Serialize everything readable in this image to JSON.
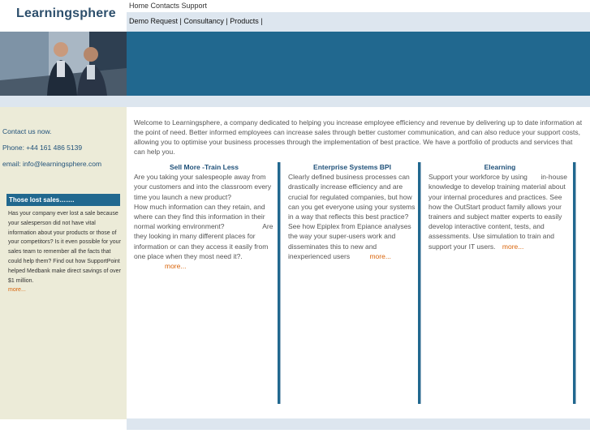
{
  "logo": "Learningsphere",
  "topnav": "Home Contacts Support",
  "subnav": "Demo Request | Consultancy | Products |",
  "sidebar": {
    "contact": "Contact us now.",
    "phone": "Phone: +44 161 486 5139",
    "email": "email: info@learningsphere.com",
    "box_title": "Those lost sales…….",
    "box_text": "Has your company ever lost a sale because your salesperson did not have vital information about your products or those of your competitors? Is it even possible for your sales team to remember all the facts that could help them? Find out how SupportPoint helped Medbank make direct savings of over  $1 million.",
    "box_more": "more..."
  },
  "welcome": "Welcome to Learningsphere, a company dedicated to helping you increase employee efficiency and revenue by delivering up to date information at the point of need. Better informed employees can increase sales through better customer communication, and can also reduce your support costs, allowing you to optimise your business processes through the implementation of best practice. We have a portfolio of products and services that can help you.",
  "columns": [
    {
      "title": "Sell More -Train Less",
      "text": "Are you taking your salespeople away from your customers and into the classroom every time you launch a new product?                       How much information can they retain, and where can they find this information in their normal working environment?                    Are they looking in many different places for information or can they access it easily from one place when they most need it?.",
      "more": "more..."
    },
    {
      "title": "Enterprise Systems BPI",
      "text": "Clearly defined business processes can drastically increase efficiency and are crucial for regulated companies, but how can you get everyone using your systems in a way that reflects this best practice? See how Epiplex from Epiance analyses the way your super-users work and disseminates this to new and inexperienced users",
      "more": "more..."
    },
    {
      "title": "Elearning",
      "text": "Support your workforce by using       in-house knowledge to develop training material about your internal procedures and practices. See how the OutStart product family allows your trainers and subject matter experts to easily develop interactive content, tests, and assessments. Use simulation to train and support your IT users.",
      "more": "more..."
    }
  ],
  "colors": {
    "banner": "#21688f",
    "pale_blue": "#dde6ef",
    "sidebar_bg": "#ecebd8",
    "link_orange": "#d9640a",
    "heading_blue": "#21527a"
  },
  "icons": [
    "business-people-photo"
  ]
}
